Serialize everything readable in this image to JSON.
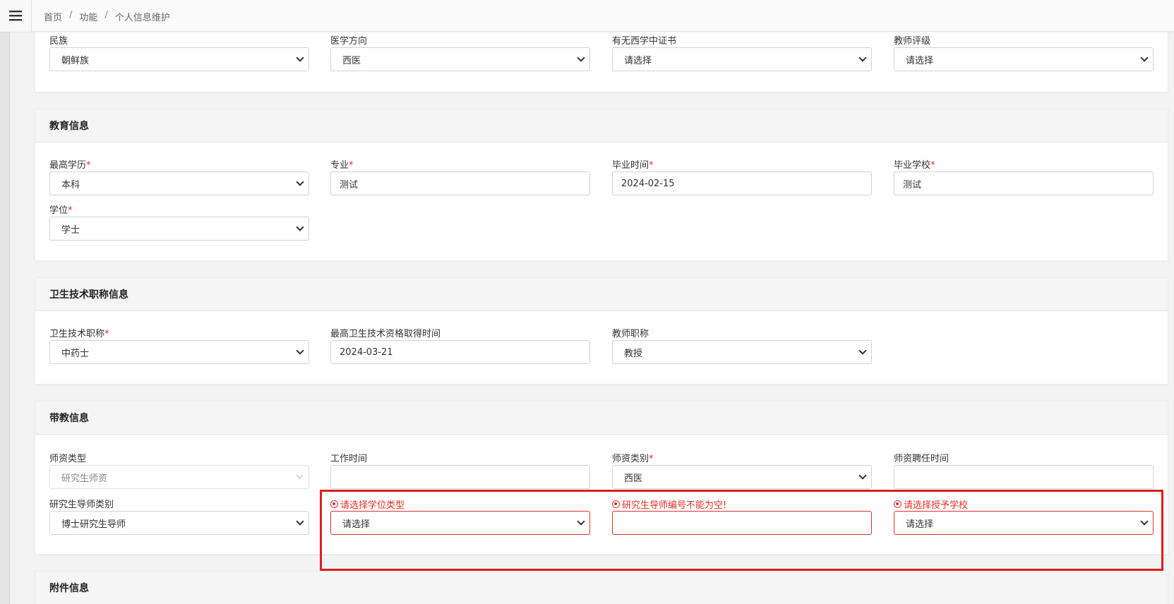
{
  "breadcrumb": [
    "首页",
    "功能",
    "个人信息维护"
  ],
  "section_basic": {
    "fields": [
      {
        "label": "民族",
        "value": "朝鲜族"
      },
      {
        "label": "医学方向",
        "value": "西医"
      },
      {
        "label": "有无西学中证书",
        "value": "请选择"
      },
      {
        "label": "教师评级",
        "value": "请选择"
      }
    ]
  },
  "section_education": {
    "title": "教育信息",
    "fields": [
      {
        "label": "最高学历",
        "value": "本科"
      },
      {
        "label": "专业",
        "value": "测试"
      },
      {
        "label": "毕业时间",
        "value": "2024-02-15"
      },
      {
        "label": "毕业学校",
        "value": "测试"
      },
      {
        "label": "学位",
        "value": "学士"
      }
    ]
  },
  "section_title": {
    "title": "卫生技术职称信息",
    "fields": [
      {
        "label": "卫生技术职称",
        "value": "中药士"
      },
      {
        "label": "最高卫生技术资格取得时间",
        "value": "2024-03-21"
      },
      {
        "label": "教师职称",
        "value": "教授"
      }
    ]
  },
  "section_teaching": {
    "title": "带教信息",
    "fields": [
      {
        "label": "师资类型",
        "value": "研究生师资"
      },
      {
        "label": "工作时间",
        "value": ""
      },
      {
        "label": "师资类别",
        "value": "西医"
      },
      {
        "label": "师资聘任时间",
        "value": ""
      },
      {
        "label": "研究生导师类别",
        "value": "博士研究生导师"
      },
      {
        "label": "请选择学位类型",
        "value": "请选择"
      },
      {
        "label": "研究生导师编号不能为空!",
        "value": ""
      },
      {
        "label": "请选择授予学校",
        "value": "请选择"
      }
    ]
  },
  "section_attachment": {
    "title": "附件信息"
  },
  "required_mark": "*",
  "colors": {
    "error": "#e0302a",
    "highlight": "#d9201e"
  }
}
